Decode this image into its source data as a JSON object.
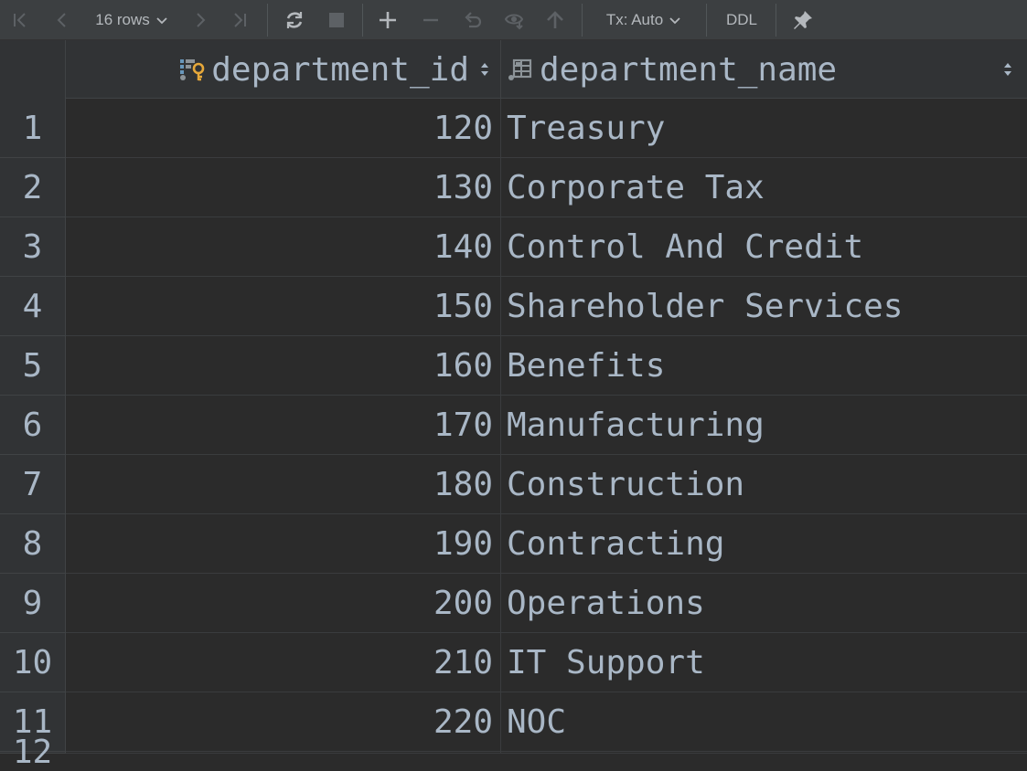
{
  "toolbar": {
    "row_count_label": "16 rows",
    "tx_label": "Tx: Auto",
    "ddl_label": "DDL"
  },
  "grid": {
    "columns": [
      {
        "name": "department_id",
        "icon": "primary-key-column-icon"
      },
      {
        "name": "department_name",
        "icon": "table-column-icon"
      }
    ],
    "rows": [
      {
        "num": "1",
        "department_id": "120",
        "department_name": "Treasury"
      },
      {
        "num": "2",
        "department_id": "130",
        "department_name": "Corporate Tax"
      },
      {
        "num": "3",
        "department_id": "140",
        "department_name": "Control And Credit"
      },
      {
        "num": "4",
        "department_id": "150",
        "department_name": "Shareholder Services"
      },
      {
        "num": "5",
        "department_id": "160",
        "department_name": "Benefits"
      },
      {
        "num": "6",
        "department_id": "170",
        "department_name": "Manufacturing"
      },
      {
        "num": "7",
        "department_id": "180",
        "department_name": "Construction"
      },
      {
        "num": "8",
        "department_id": "190",
        "department_name": "Contracting"
      },
      {
        "num": "9",
        "department_id": "200",
        "department_name": "Operations"
      },
      {
        "num": "10",
        "department_id": "210",
        "department_name": "IT Support"
      },
      {
        "num": "11",
        "department_id": "220",
        "department_name": "NOC"
      },
      {
        "num": "12",
        "department_id": "",
        "department_name": ""
      }
    ]
  },
  "colors": {
    "background": "#2b2b2b",
    "toolbar": "#3c3f41",
    "text": "#a9b7c6",
    "key_icon": "#e6a83a"
  }
}
